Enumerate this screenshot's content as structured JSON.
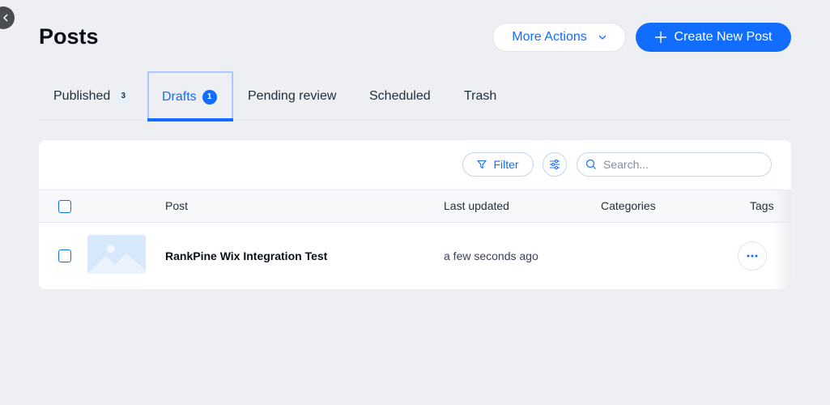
{
  "page": {
    "title": "Posts"
  },
  "header": {
    "more_actions_label": "More Actions",
    "create_label": "Create New Post"
  },
  "tabs": [
    {
      "label": "Published",
      "count": "3"
    },
    {
      "label": "Drafts",
      "count": "1",
      "active": true
    },
    {
      "label": "Pending review"
    },
    {
      "label": "Scheduled"
    },
    {
      "label": "Trash"
    }
  ],
  "toolbar": {
    "filter_label": "Filter",
    "search_placeholder": "Search..."
  },
  "table": {
    "columns": [
      "Post",
      "Last updated",
      "Categories",
      "Tags"
    ],
    "rows": [
      {
        "title": "RankPine Wix Integration Test",
        "last_updated": "a few seconds ago"
      }
    ]
  },
  "colors": {
    "accent": "#116dff",
    "background": "#eeeff3",
    "card": "#ffffff"
  },
  "icons": [
    "chevron-left-icon",
    "chevron-down-icon",
    "plus-icon",
    "filter-icon",
    "sliders-icon",
    "search-icon",
    "image-placeholder-icon",
    "ellipsis-icon"
  ]
}
